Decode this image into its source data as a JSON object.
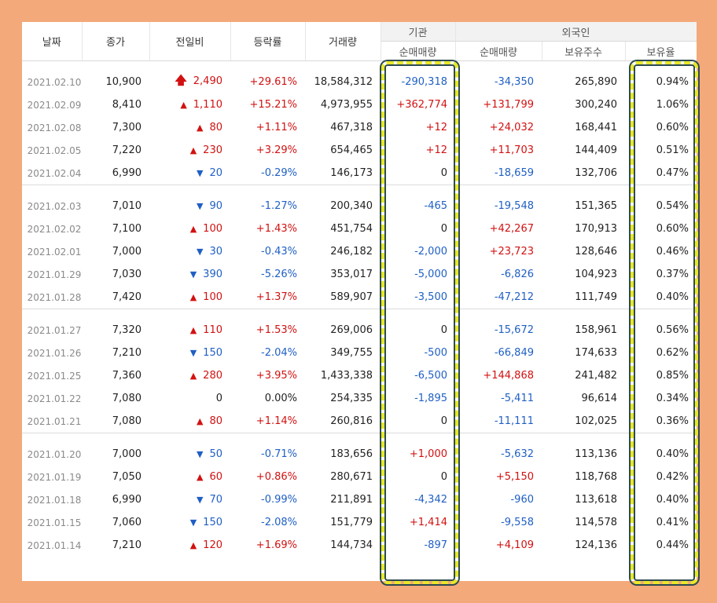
{
  "headers": {
    "date": "날짜",
    "close": "종가",
    "diff": "전일비",
    "rate": "등락률",
    "volume": "거래량",
    "institution": "기관",
    "foreign": "외국인",
    "inst_net": "순매매량",
    "foreign_net": "순매매량",
    "foreign_hold": "보유주수",
    "foreign_rate": "보유율"
  },
  "colors": {
    "up": "#d21111",
    "down": "#1f5fc4",
    "highlight_border": "#e8e827",
    "page_bg": "#f4a97a"
  },
  "groups": [
    [
      {
        "date": "2021.02.10",
        "close": "10,900",
        "dir": "upper",
        "diff": "2,490",
        "rate": "+29.61%",
        "volume": "18,584,312",
        "inst": "-290,318",
        "fnet": "-34,350",
        "fhold": "265,890",
        "frate": "0.94%"
      },
      {
        "date": "2021.02.09",
        "close": "8,410",
        "dir": "up",
        "diff": "1,110",
        "rate": "+15.21%",
        "volume": "4,973,955",
        "inst": "+362,774",
        "fnet": "+131,799",
        "fhold": "300,240",
        "frate": "1.06%"
      },
      {
        "date": "2021.02.08",
        "close": "7,300",
        "dir": "up",
        "diff": "80",
        "rate": "+1.11%",
        "volume": "467,318",
        "inst": "+12",
        "fnet": "+24,032",
        "fhold": "168,441",
        "frate": "0.60%"
      },
      {
        "date": "2021.02.05",
        "close": "7,220",
        "dir": "up",
        "diff": "230",
        "rate": "+3.29%",
        "volume": "654,465",
        "inst": "+12",
        "fnet": "+11,703",
        "fhold": "144,409",
        "frate": "0.51%"
      },
      {
        "date": "2021.02.04",
        "close": "6,990",
        "dir": "down",
        "diff": "20",
        "rate": "-0.29%",
        "volume": "146,173",
        "inst": "0",
        "fnet": "-18,659",
        "fhold": "132,706",
        "frate": "0.47%"
      }
    ],
    [
      {
        "date": "2021.02.03",
        "close": "7,010",
        "dir": "down",
        "diff": "90",
        "rate": "-1.27%",
        "volume": "200,340",
        "inst": "-465",
        "fnet": "-19,548",
        "fhold": "151,365",
        "frate": "0.54%"
      },
      {
        "date": "2021.02.02",
        "close": "7,100",
        "dir": "up",
        "diff": "100",
        "rate": "+1.43%",
        "volume": "451,754",
        "inst": "0",
        "fnet": "+42,267",
        "fhold": "170,913",
        "frate": "0.60%"
      },
      {
        "date": "2021.02.01",
        "close": "7,000",
        "dir": "down",
        "diff": "30",
        "rate": "-0.43%",
        "volume": "246,182",
        "inst": "-2,000",
        "fnet": "+23,723",
        "fhold": "128,646",
        "frate": "0.46%"
      },
      {
        "date": "2021.01.29",
        "close": "7,030",
        "dir": "down",
        "diff": "390",
        "rate": "-5.26%",
        "volume": "353,017",
        "inst": "-5,000",
        "fnet": "-6,826",
        "fhold": "104,923",
        "frate": "0.37%"
      },
      {
        "date": "2021.01.28",
        "close": "7,420",
        "dir": "up",
        "diff": "100",
        "rate": "+1.37%",
        "volume": "589,907",
        "inst": "-3,500",
        "fnet": "-47,212",
        "fhold": "111,749",
        "frate": "0.40%"
      }
    ],
    [
      {
        "date": "2021.01.27",
        "close": "7,320",
        "dir": "up",
        "diff": "110",
        "rate": "+1.53%",
        "volume": "269,006",
        "inst": "0",
        "fnet": "-15,672",
        "fhold": "158,961",
        "frate": "0.56%"
      },
      {
        "date": "2021.01.26",
        "close": "7,210",
        "dir": "down",
        "diff": "150",
        "rate": "-2.04%",
        "volume": "349,755",
        "inst": "-500",
        "fnet": "-66,849",
        "fhold": "174,633",
        "frate": "0.62%"
      },
      {
        "date": "2021.01.25",
        "close": "7,360",
        "dir": "up",
        "diff": "280",
        "rate": "+3.95%",
        "volume": "1,433,338",
        "inst": "-6,500",
        "fnet": "+144,868",
        "fhold": "241,482",
        "frate": "0.85%"
      },
      {
        "date": "2021.01.22",
        "close": "7,080",
        "dir": "flat",
        "diff": "0",
        "rate": "0.00%",
        "volume": "254,335",
        "inst": "-1,895",
        "fnet": "-5,411",
        "fhold": "96,614",
        "frate": "0.34%"
      },
      {
        "date": "2021.01.21",
        "close": "7,080",
        "dir": "up",
        "diff": "80",
        "rate": "+1.14%",
        "volume": "260,816",
        "inst": "0",
        "fnet": "-11,111",
        "fhold": "102,025",
        "frate": "0.36%"
      }
    ],
    [
      {
        "date": "2021.01.20",
        "close": "7,000",
        "dir": "down",
        "diff": "50",
        "rate": "-0.71%",
        "volume": "183,656",
        "inst": "+1,000",
        "fnet": "-5,632",
        "fhold": "113,136",
        "frate": "0.40%"
      },
      {
        "date": "2021.01.19",
        "close": "7,050",
        "dir": "up",
        "diff": "60",
        "rate": "+0.86%",
        "volume": "280,671",
        "inst": "0",
        "fnet": "+5,150",
        "fhold": "118,768",
        "frate": "0.42%"
      },
      {
        "date": "2021.01.18",
        "close": "6,990",
        "dir": "down",
        "diff": "70",
        "rate": "-0.99%",
        "volume": "211,891",
        "inst": "-4,342",
        "fnet": "-960",
        "fhold": "113,618",
        "frate": "0.40%"
      },
      {
        "date": "2021.01.15",
        "close": "7,060",
        "dir": "down",
        "diff": "150",
        "rate": "-2.08%",
        "volume": "151,779",
        "inst": "+1,414",
        "fnet": "-9,558",
        "fhold": "114,578",
        "frate": "0.41%"
      },
      {
        "date": "2021.01.14",
        "close": "7,210",
        "dir": "up",
        "diff": "120",
        "rate": "+1.69%",
        "volume": "144,734",
        "inst": "-897",
        "fnet": "+4,109",
        "fhold": "124,136",
        "frate": "0.44%"
      }
    ]
  ]
}
